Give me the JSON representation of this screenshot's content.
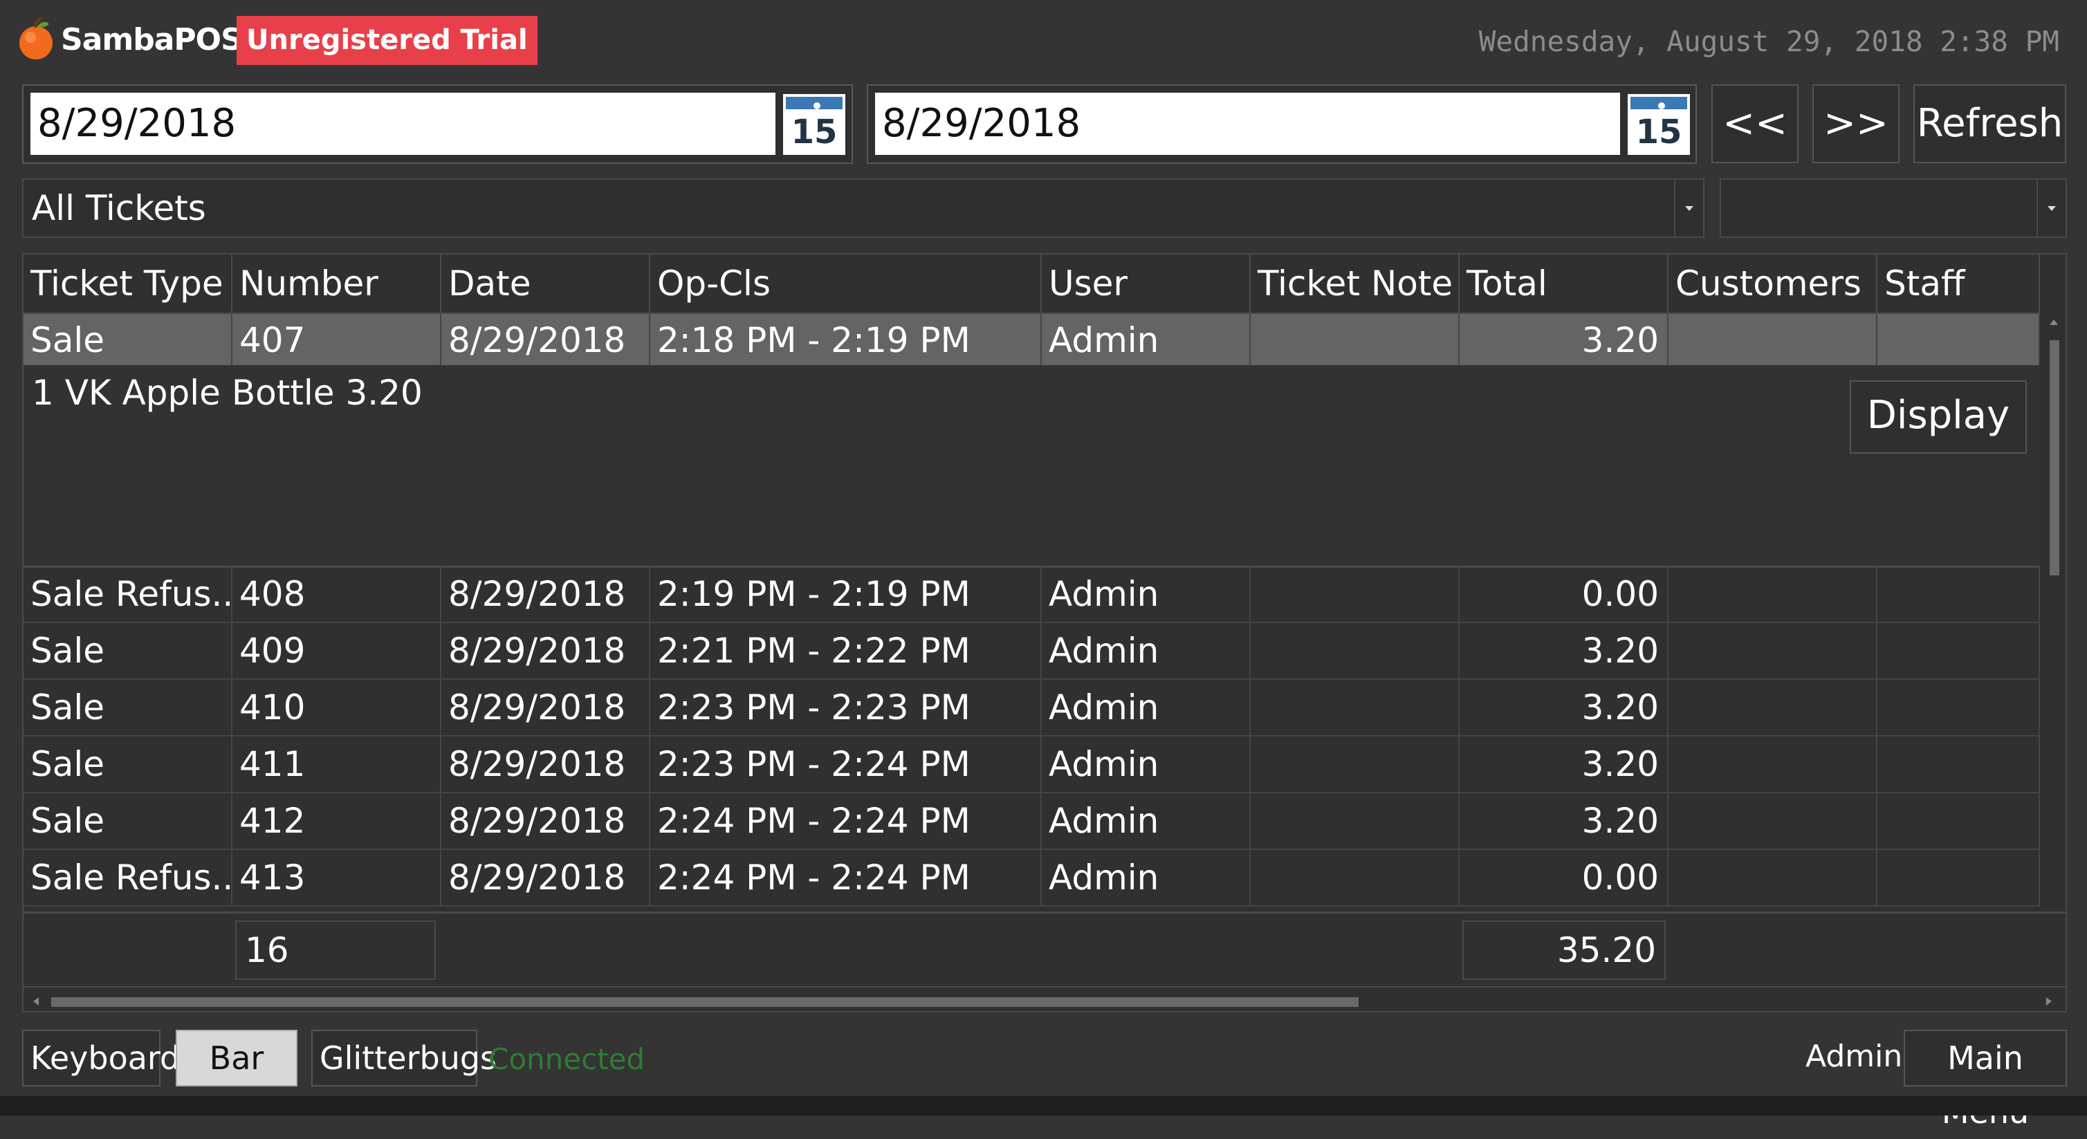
{
  "app": {
    "name": "SambaPOS",
    "trial_badge": "Unregistered Trial",
    "datetime": "Wednesday, August 29, 2018 2:38 PM",
    "accent_color": "#e8404a"
  },
  "filters": {
    "start_date": "8/29/2018",
    "end_date": "8/29/2018",
    "calendar_day": "15",
    "prev_label": "<<",
    "next_label": ">>",
    "refresh_label": "Refresh",
    "ticket_filter": "All Tickets",
    "secondary_filter": ""
  },
  "grid": {
    "columns": [
      "Ticket Type",
      "Number",
      "Date",
      "Op-Cls",
      "User",
      "Ticket Note",
      "Total",
      "Customers",
      "Staff"
    ],
    "selected_row": {
      "type": "Sale",
      "number": "407",
      "date": "8/29/2018",
      "opcls": "2:18 PM - 2:19 PM",
      "user": "Admin",
      "note": "",
      "total": "3.20",
      "customers": "",
      "staff": ""
    },
    "detail": {
      "text": "1 VK Apple Bottle 3.20",
      "display_label": "Display"
    },
    "rows": [
      {
        "type": "Sale Refus...",
        "number": "408",
        "date": "8/29/2018",
        "opcls": "2:19 PM - 2:19 PM",
        "user": "Admin",
        "note": "",
        "total": "0.00",
        "customers": "",
        "staff": ""
      },
      {
        "type": "Sale",
        "number": "409",
        "date": "8/29/2018",
        "opcls": "2:21 PM - 2:22 PM",
        "user": "Admin",
        "note": "",
        "total": "3.20",
        "customers": "",
        "staff": ""
      },
      {
        "type": "Sale",
        "number": "410",
        "date": "8/29/2018",
        "opcls": "2:23 PM - 2:23 PM",
        "user": "Admin",
        "note": "",
        "total": "3.20",
        "customers": "",
        "staff": ""
      },
      {
        "type": "Sale",
        "number": "411",
        "date": "8/29/2018",
        "opcls": "2:23 PM - 2:24 PM",
        "user": "Admin",
        "note": "",
        "total": "3.20",
        "customers": "",
        "staff": ""
      },
      {
        "type": "Sale",
        "number": "412",
        "date": "8/29/2018",
        "opcls": "2:24 PM - 2:24 PM",
        "user": "Admin",
        "note": "",
        "total": "3.20",
        "customers": "",
        "staff": ""
      },
      {
        "type": "Sale Refus...",
        "number": "413",
        "date": "8/29/2018",
        "opcls": "2:24 PM - 2:24 PM",
        "user": "Admin",
        "note": "",
        "total": "0.00",
        "customers": "",
        "staff": ""
      }
    ],
    "summary": {
      "count": "16",
      "total": "35.20"
    }
  },
  "bottom_bar": {
    "keyboard_label": "Keyboard",
    "bar_label": "Bar",
    "glitterbugs_label": "Glitterbugs",
    "status": "Connected",
    "status_color": "#2e7d32",
    "user": "Admin",
    "main_menu_label": "Main Menu"
  }
}
